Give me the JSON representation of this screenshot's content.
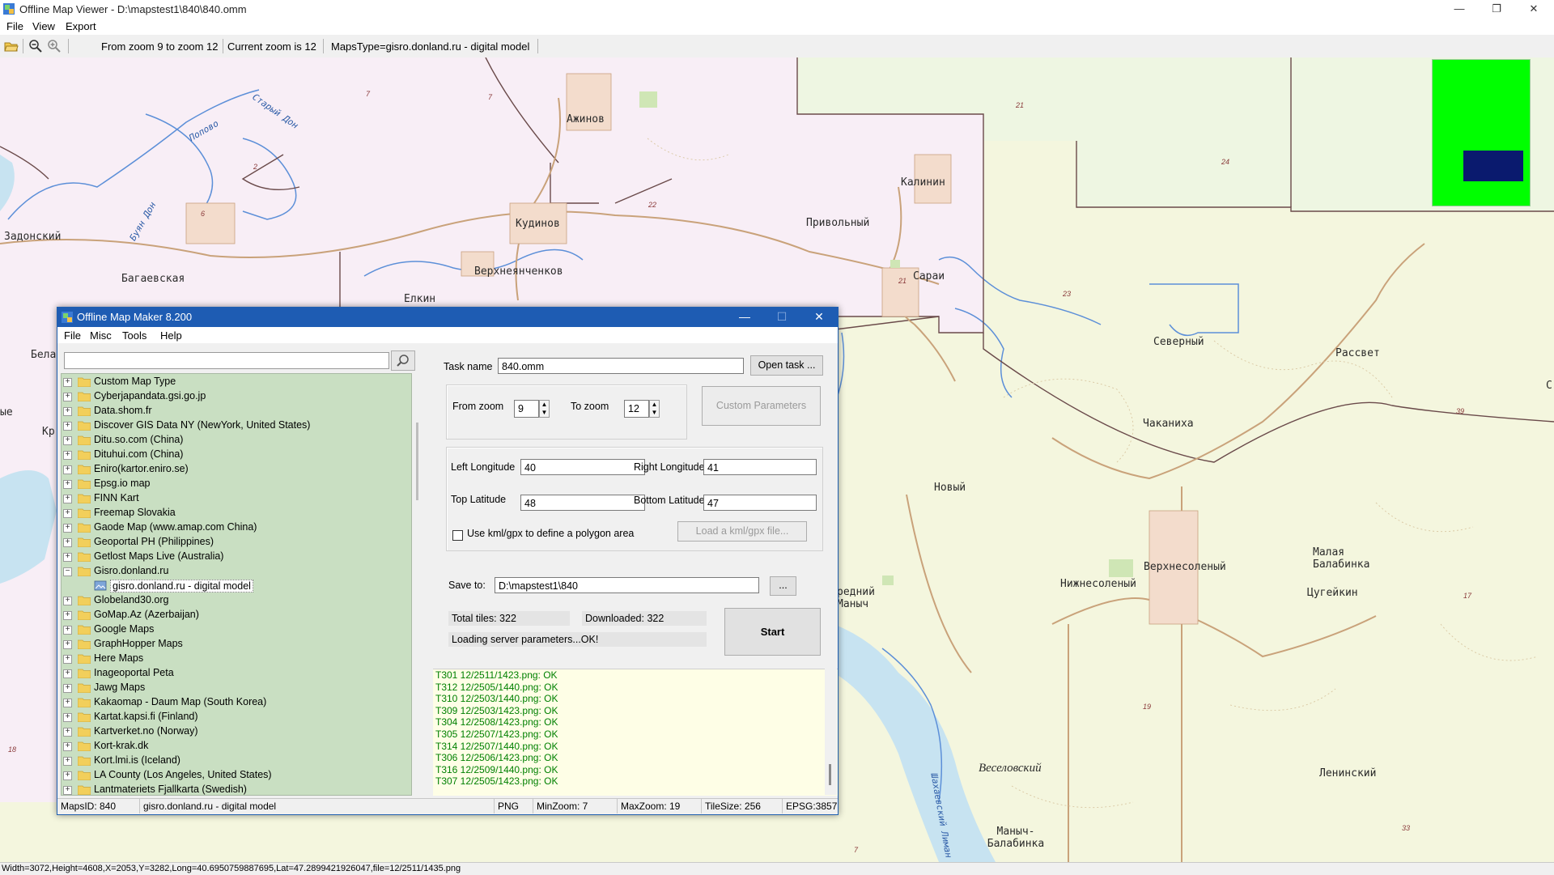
{
  "window": {
    "title": "Offline Map Viewer - D:\\mapstest1\\840\\840.omm",
    "controls": {
      "minimize": "—",
      "restore": "❐",
      "close": "✕"
    }
  },
  "menu": [
    "File",
    "View",
    "Export"
  ],
  "toolbar": {
    "zoom_range": "From zoom 9 to zoom 12",
    "current_zoom": "Current zoom is 12",
    "maps_type": "MapsType=gisro.donland.ru - digital model"
  },
  "map": {
    "places": [
      "Ажинов",
      "Калинин",
      "Задонский",
      "Кудинов",
      "Привольный",
      "Сараи",
      "Багаевская",
      "Верхнеянченков",
      "Елкин",
      "Северный",
      "Рассвет",
      "Чаканиха",
      "Новый",
      "Малая Балабинка",
      "Верхнесоленый",
      "Нижнесоленый",
      "Цугейкин",
      "Веселовский",
      "Ленинский",
      "Маныч-Балабинка",
      "Бела",
      "Кр",
      "С",
      "ые",
      "редний Маныч"
    ],
    "water_labels": [
      "Старый Дон",
      "Попово",
      "Буян Дон",
      "Шахаевский Лиман"
    ],
    "heights": [
      "7",
      "7",
      "21",
      "24",
      "6",
      "2",
      "22",
      "21",
      "23",
      "39",
      "17",
      "19",
      "33",
      "18",
      "7"
    ]
  },
  "statusbar": "Width=3072,Height=4608,X=2053,Y=3282,Long=40.6950759887695,Lat=47.2899421926047,file=12/2511/1435.png",
  "dialog": {
    "title": "Offline Map Maker 8.200",
    "menu": [
      "File",
      "Misc",
      "Tools",
      "Help"
    ],
    "search": {
      "value": "",
      "placeholder": ""
    },
    "tree": [
      {
        "label": "Custom Map Type",
        "level": 0
      },
      {
        "label": "Cyberjapandata.gsi.go.jp",
        "level": 0
      },
      {
        "label": "Data.shom.fr",
        "level": 0
      },
      {
        "label": "Discover GIS Data NY (NewYork, United States)",
        "level": 0
      },
      {
        "label": "Ditu.so.com (China)",
        "level": 0
      },
      {
        "label": "Dituhui.com (China)",
        "level": 0
      },
      {
        "label": "Eniro(kartor.eniro.se)",
        "level": 0
      },
      {
        "label": "Epsg.io map",
        "level": 0
      },
      {
        "label": "FINN Kart",
        "level": 0
      },
      {
        "label": "Freemap Slovakia",
        "level": 0
      },
      {
        "label": "Gaode Map (www.amap.com China)",
        "level": 0
      },
      {
        "label": "Geoportal PH (Philippines)",
        "level": 0
      },
      {
        "label": "Getlost Maps Live (Australia)",
        "level": 0
      },
      {
        "label": "Gisro.donland.ru",
        "level": 0,
        "expanded": true
      },
      {
        "label": "gisro.donland.ru - digital model",
        "level": 1,
        "selected": true
      },
      {
        "label": "Globeland30.org",
        "level": 0
      },
      {
        "label": "GoMap.Az (Azerbaijan)",
        "level": 0
      },
      {
        "label": "Google Maps",
        "level": 0
      },
      {
        "label": "GraphHopper Maps",
        "level": 0
      },
      {
        "label": "Here Maps",
        "level": 0
      },
      {
        "label": "Inageoportal Peta",
        "level": 0
      },
      {
        "label": "Jawg Maps",
        "level": 0
      },
      {
        "label": "Kakaomap - Daum Map (South Korea)",
        "level": 0
      },
      {
        "label": "Kartat.kapsi.fi (Finland)",
        "level": 0
      },
      {
        "label": "Kartverket.no (Norway)",
        "level": 0
      },
      {
        "label": "Kort-krak.dk",
        "level": 0
      },
      {
        "label": "Kort.lmi.is (Iceland)",
        "level": 0
      },
      {
        "label": "LA County (Los Angeles, United States)",
        "level": 0
      },
      {
        "label": "Lantmateriets Fjallkarta (Swedish)",
        "level": 0
      }
    ],
    "task_label": "Task name",
    "task_value": "840.omm",
    "open_task": "Open task ...",
    "from_zoom_label": "From zoom",
    "from_zoom": "9",
    "to_zoom_label": "To zoom",
    "to_zoom": "12",
    "custom_params": "Custom Parameters",
    "left_lon_label": "Left Longitude",
    "left_lon": "40",
    "right_lon_label": "Right Longitude",
    "right_lon": "41",
    "top_lat_label": "Top Latitude",
    "top_lat": "48",
    "bottom_lat_label": "Bottom Latitude",
    "bottom_lat": "47",
    "kml_check_label": "Use kml/gpx to define a polygon area",
    "kml_checked": false,
    "kml_button": "Load a kml/gpx file...",
    "save_label": "Save to:",
    "save_path": "D:\\mapstest1\\840",
    "browse": "...",
    "total_tiles": "Total tiles: 322",
    "downloaded": "Downloaded: 322",
    "loading": "Loading server parameters...OK!",
    "start": "Start",
    "log": [
      "T301 12/2511/1423.png: OK",
      "T312 12/2505/1440.png: OK",
      "T310 12/2503/1440.png: OK",
      "T309 12/2503/1423.png: OK",
      "T304 12/2508/1423.png: OK",
      "T305 12/2507/1423.png: OK",
      "T314 12/2507/1440.png: OK",
      "T306 12/2506/1423.png: OK",
      "T316 12/2509/1440.png: OK",
      "T307 12/2505/1423.png: OK"
    ],
    "status": {
      "maps_id": "MapsID: 840",
      "map_name": "gisro.donland.ru - digital model",
      "format": "PNG",
      "min_zoom": "MinZoom: 7",
      "max_zoom": "MaxZoom: 19",
      "tile_size": "TileSize: 256",
      "epsg": "EPSG:3857"
    }
  },
  "colors": {
    "map_pink": "#f8eef6",
    "map_green": "#eef6e2",
    "map_yellow": "#f4f6de",
    "water": "#c7e3f1",
    "river_line": "#5c8fd8",
    "road": "#c9a27a",
    "tree_bg": "#c9dfc2",
    "log_bg": "#fefee6",
    "log_text": "#008000",
    "dialog_title": "#1e5cb3",
    "minimap": "#00ff00",
    "minimap_view": "#0a1a6e"
  }
}
